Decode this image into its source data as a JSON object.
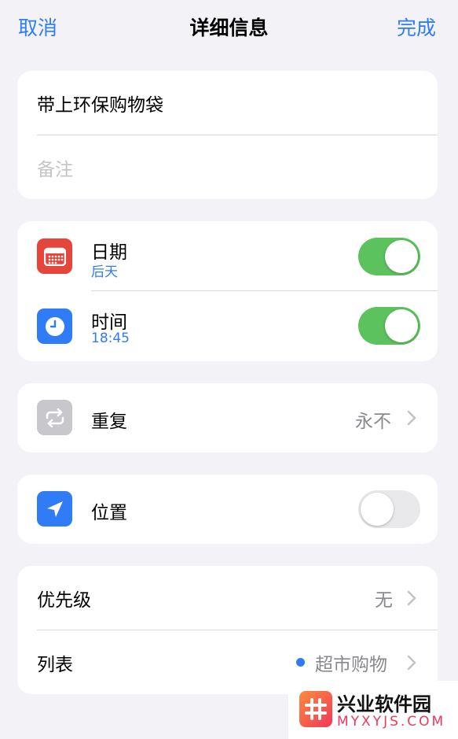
{
  "nav": {
    "cancel": "取消",
    "title": "详细信息",
    "done": "完成"
  },
  "task": {
    "title": "带上环保购物袋",
    "notes_placeholder": "备注"
  },
  "date_time": {
    "date_label": "日期",
    "date_value": "后天",
    "date_on": true,
    "time_label": "时间",
    "time_value": "18:45",
    "time_on": true
  },
  "repeat": {
    "label": "重复",
    "value": "永不"
  },
  "location": {
    "label": "位置",
    "on": false
  },
  "priority": {
    "label": "优先级",
    "value": "无"
  },
  "list": {
    "label": "列表",
    "value": "超市购物",
    "dot_color": "#2f7cf6"
  },
  "watermark": {
    "title": "兴业软件园",
    "sub": "MYXYJS.COM"
  },
  "colors": {
    "accent": "#2f7cf6",
    "toggle_on": "#5bc25d",
    "calendar_icon": "#e5453a",
    "clock_icon": "#2f7cf6",
    "repeat_icon": "#c7c7cc",
    "location_icon": "#2f7cf6"
  },
  "icons": [
    "calendar-icon",
    "clock-icon",
    "repeat-icon",
    "location-arrow-icon",
    "chevron-right-icon"
  ]
}
